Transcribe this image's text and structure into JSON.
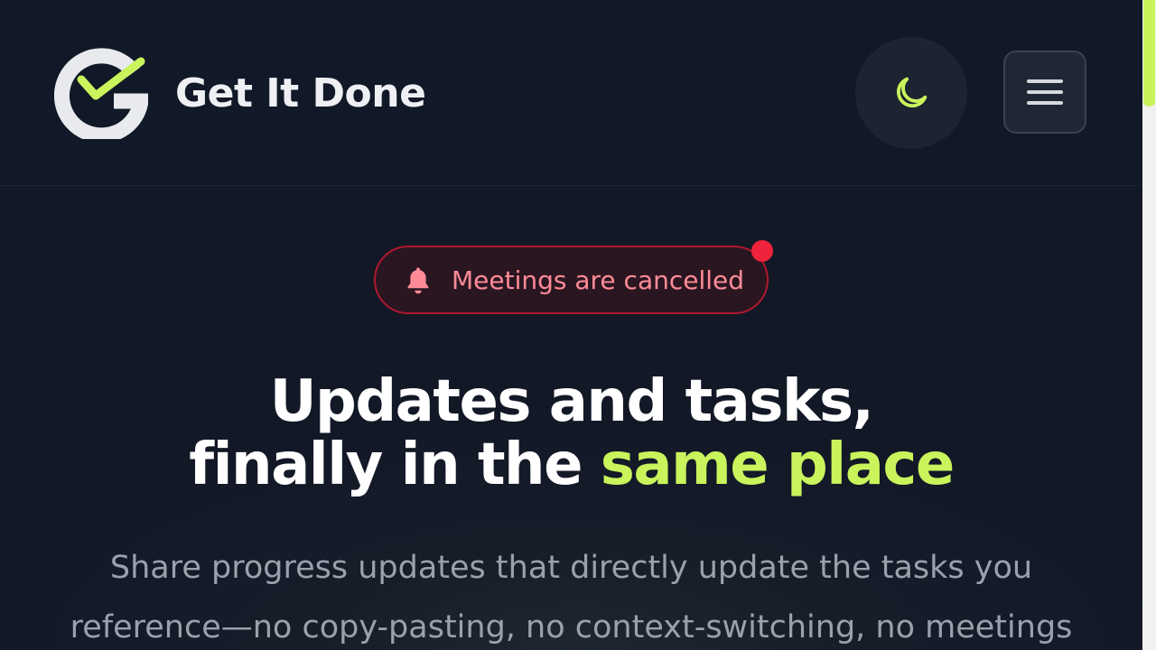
{
  "header": {
    "brand": "Get It Done",
    "theme_toggle_icon": "moon-icon",
    "menu_icon": "hamburger-menu-icon"
  },
  "alert": {
    "icon": "bell-icon",
    "text": "Meetings are cancelled"
  },
  "hero": {
    "title_line1": "Updates and tasks,",
    "title_line2_prefix": "finally in the ",
    "title_line2_accent": "same place",
    "subtitle_line1": "Share progress updates that directly update the tasks you",
    "subtitle_line2": "reference—no copy-pasting, no context-switching, no meetings"
  },
  "colors": {
    "background": "#111827",
    "accent": "#c9f45c",
    "alert_border": "#b0182e",
    "alert_text": "#ff8b98",
    "alert_dot": "#ef233c"
  }
}
